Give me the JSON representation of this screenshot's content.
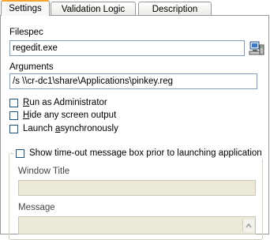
{
  "tabs": [
    {
      "label": "Settings",
      "active": true
    },
    {
      "label": "Validation Logic",
      "active": false
    },
    {
      "label": "Description",
      "active": false
    }
  ],
  "filespec": {
    "label": "Filespec",
    "value": "regedit.exe",
    "browse_icon": "computer-browse-icon"
  },
  "arguments": {
    "label": "Arguments",
    "value": "/s \\\\cr-dc1\\share\\Applications\\pinkey.reg"
  },
  "options": [
    {
      "pre": "",
      "accel": "R",
      "post": "un as Administrator",
      "checked": false
    },
    {
      "pre": "",
      "accel": "H",
      "post": "ide any screen output",
      "checked": false
    },
    {
      "pre": "Launch ",
      "accel": "a",
      "post": "synchronously",
      "checked": false
    }
  ],
  "timeout_group": {
    "checkbox_label": "Show time-out message box prior to launching application",
    "checked": false,
    "window_title": {
      "label": "Window Title",
      "value": ""
    },
    "message": {
      "label": "Message",
      "value": ""
    }
  },
  "colors": {
    "active_tab_accent": "#f7a531",
    "border": "#919b9c",
    "field_border": "#7f9db9",
    "disabled_field": "#ece9d8"
  }
}
